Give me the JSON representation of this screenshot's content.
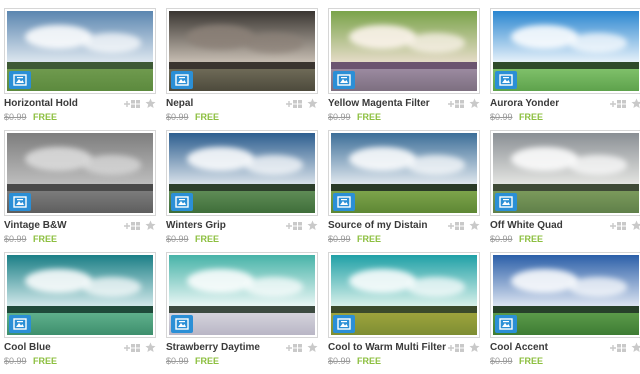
{
  "filters": [
    {
      "title": "Horizontal Hold",
      "old_price": "$0.99",
      "price": "FREE",
      "colors": {
        "sky_top": "#5b86b0",
        "sky_bottom": "#eef3f7",
        "cloud": "#ffffff",
        "horizon": "#3e5a35",
        "ground_top": "#6f9a4e",
        "ground_bottom": "#5c8a3e"
      }
    },
    {
      "title": "Nepal",
      "old_price": "$0.99",
      "price": "FREE",
      "colors": {
        "sky_top": "#3a3632",
        "sky_bottom": "#d9cfc3",
        "cloud": "#8c8178",
        "horizon": "#3b3530",
        "ground_top": "#6e6a57",
        "ground_bottom": "#4d4a3c"
      }
    },
    {
      "title": "Yellow Magenta Filter",
      "old_price": "$0.99",
      "price": "FREE",
      "colors": {
        "sky_top": "#7aa34a",
        "sky_bottom": "#f3e3d8",
        "cloud": "#fff6f0",
        "horizon": "#6b5470",
        "ground_top": "#9b8aa0",
        "ground_bottom": "#7d6f80"
      }
    },
    {
      "title": "Aurora Yonder",
      "old_price": "$0.99",
      "price": "FREE",
      "colors": {
        "sky_top": "#2a86d0",
        "sky_bottom": "#ffffff",
        "cloud": "#ffffff",
        "horizon": "#2e4a2a",
        "ground_top": "#7fc06a",
        "ground_bottom": "#5ea24c"
      }
    },
    {
      "title": "Vintage B&W",
      "old_price": "$0.99",
      "price": "FREE",
      "colors": {
        "sky_top": "#7d7d7d",
        "sky_bottom": "#c6c6c6",
        "cloud": "#dedede",
        "horizon": "#4a4a4a",
        "ground_top": "#7c7c7c",
        "ground_bottom": "#5e5e5e"
      }
    },
    {
      "title": "Winters Grip",
      "old_price": "$0.99",
      "price": "FREE",
      "colors": {
        "sky_top": "#2d5e8f",
        "sky_bottom": "#eef2f5",
        "cloud": "#ffffff",
        "horizon": "#2c3f2b",
        "ground_top": "#5f8c56",
        "ground_bottom": "#3f6e3a"
      }
    },
    {
      "title": "Source of my Distain",
      "old_price": "$0.99",
      "price": "FREE",
      "colors": {
        "sky_top": "#3c6e98",
        "sky_bottom": "#f5f7f9",
        "cloud": "#ffffff",
        "horizon": "#2a3a27",
        "ground_top": "#7da44b",
        "ground_bottom": "#5e8735"
      }
    },
    {
      "title": "Off White Quad",
      "old_price": "$0.99",
      "price": "FREE",
      "colors": {
        "sky_top": "#8a8f94",
        "sky_bottom": "#f0f0ec",
        "cloud": "#ffffff",
        "horizon": "#3f4a36",
        "ground_top": "#7b9a5b",
        "ground_bottom": "#60804a"
      }
    },
    {
      "title": "Cool Blue",
      "old_price": "$0.99",
      "price": "FREE",
      "colors": {
        "sky_top": "#1b7f86",
        "sky_bottom": "#e9f6f7",
        "cloud": "#ffffff",
        "horizon": "#1f4a3a",
        "ground_top": "#5fb08c",
        "ground_bottom": "#3e8f6d"
      }
    },
    {
      "title": "Strawberry Daytime",
      "old_price": "$0.99",
      "price": "FREE",
      "colors": {
        "sky_top": "#47b3a8",
        "sky_bottom": "#ffffff",
        "cloud": "#ffffff",
        "horizon": "#3c4a40",
        "ground_top": "#d4d3dc",
        "ground_bottom": "#b9b6c6"
      }
    },
    {
      "title": "Cool to Warm Multi Filter",
      "old_price": "$0.99",
      "price": "FREE",
      "colors": {
        "sky_top": "#1fa0a6",
        "sky_bottom": "#f1fbf3",
        "cloud": "#ffffff",
        "horizon": "#3b4a2b",
        "ground_top": "#9da33c",
        "ground_bottom": "#7e8e33"
      }
    },
    {
      "title": "Cool Accent",
      "old_price": "$0.99",
      "price": "FREE",
      "colors": {
        "sky_top": "#2b5fa8",
        "sky_bottom": "#f4f6fb",
        "cloud": "#ffffff",
        "horizon": "#27402a",
        "ground_top": "#5b9a4a",
        "ground_bottom": "#3e7c34"
      }
    }
  ],
  "ui": {
    "badge_color": "#2b8fd6",
    "free_color": "#8cbf3f",
    "icons": [
      "image-badge-icon",
      "add-grid-icon",
      "star-icon"
    ]
  }
}
